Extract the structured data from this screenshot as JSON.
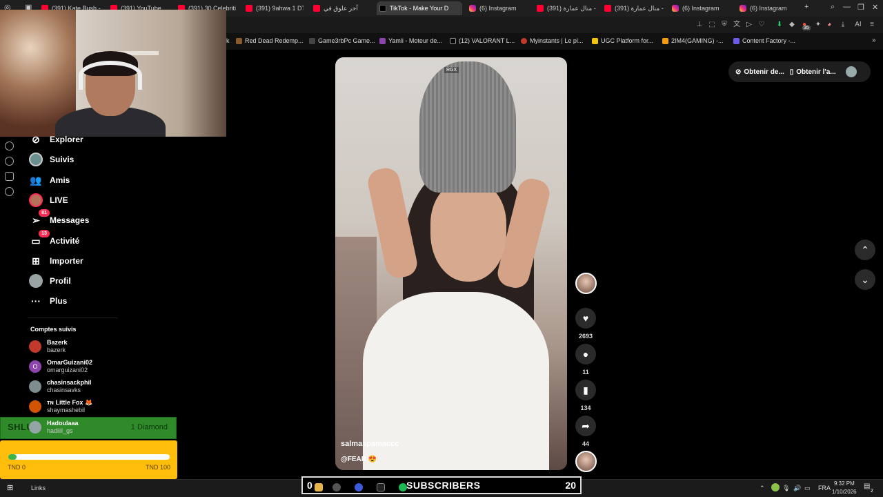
{
  "browser": {
    "tabs": [
      {
        "label": "(391) Kate Bush -",
        "icon": "youtube-icon"
      },
      {
        "label": "(391) YouTube",
        "icon": "youtube-icon"
      },
      {
        "label": "(391) 30 Celebriti",
        "icon": "youtube-icon"
      },
      {
        "label": "(391) 9ahwa 1 DT",
        "icon": "youtube-icon"
      },
      {
        "label": "آخر علوق في",
        "icon": "youtube-icon"
      },
      {
        "label": "TikTok - Make Your D",
        "icon": "tiktok-icon",
        "active": true
      },
      {
        "label": "(6) Instagram",
        "icon": "instagram-icon"
      },
      {
        "label": "(391) منال عمارة -",
        "icon": "youtube-icon"
      },
      {
        "label": "(391) منال عمارة -",
        "icon": "youtube-icon"
      },
      {
        "label": "(6) Instagram",
        "icon": "instagram-icon"
      },
      {
        "label": "(6) Instagram",
        "icon": "instagram-icon"
      }
    ],
    "new_tab": "+",
    "toolbar_ai": "AI",
    "bookmarks": [
      {
        "label": "k",
        "color": "#000"
      },
      {
        "label": "Red Dead Redemp...",
        "color": "#8b5a2b"
      },
      {
        "label": "Game3rbPc Game...",
        "color": "#444"
      },
      {
        "label": "Yamli - Moteur de...",
        "color": "#8e44ad"
      },
      {
        "label": "(12) VALORANT L...",
        "color": "#000"
      },
      {
        "label": "Myinstants | Le pl...",
        "color": "#c0392b"
      },
      {
        "label": "UGC Platform for...",
        "color": "#f1c40f"
      },
      {
        "label": "2IM4(GAMING) -...",
        "color": "#f39c12"
      },
      {
        "label": "Content Factory -...",
        "color": "#6c5ce7"
      }
    ],
    "toolbar_badge": "35"
  },
  "sidebar": {
    "items": [
      {
        "label": "Explorer",
        "icon": "compass-icon"
      },
      {
        "label": "Suivis",
        "icon": "following-avatar-icon"
      },
      {
        "label": "Amis",
        "icon": "friends-icon"
      },
      {
        "label": "LIVE",
        "icon": "live-avatar-icon"
      },
      {
        "label": "Messages",
        "icon": "messages-icon",
        "badge": "81"
      },
      {
        "label": "Activité",
        "icon": "activity-icon",
        "badge": "13"
      },
      {
        "label": "Importer",
        "icon": "upload-icon"
      },
      {
        "label": "Profil",
        "icon": "profile-avatar-icon"
      },
      {
        "label": "Plus",
        "icon": "more-icon"
      }
    ],
    "followed_title": "Comptes suivis",
    "accounts": [
      {
        "name": "Bazerk",
        "handle": "bazerk",
        "avatar_color": "#c0392b"
      },
      {
        "name": "OmarGuizani02",
        "handle": "omarguizani02",
        "avatar_color": "#8e44ad",
        "initial": "O"
      },
      {
        "name": "chasinsackphil",
        "handle": "chasinsavks",
        "avatar_color": "#7f8c8d"
      },
      {
        "name": "ᴛɴ Little Fox 🦊",
        "handle": "shaymashebil",
        "avatar_color": "#d35400"
      },
      {
        "name": "Hadoulaaa",
        "handle": "hadiiil_gs",
        "avatar_color": "#95a5a6"
      }
    ]
  },
  "overlay": {
    "green_left": "SHLUP",
    "green_right": "1 Diamond",
    "goal_min": "TND 0",
    "goal_max": "TND 100",
    "goal_progress_pct": 5,
    "subscribers_prefix": "0",
    "subscribers_label": "SUBSCRIBERS",
    "subscribers_count": "20"
  },
  "video": {
    "watermark": "RGX",
    "username": "salmaspamaccc",
    "caption": "@FEAR 😍",
    "likes": "2693",
    "comments": "11",
    "saves": "134",
    "shares": "44"
  },
  "top_actions": {
    "get_coins": "Obtenir de...",
    "get_app": "Obtenir l'a..."
  },
  "taskbar": {
    "links": "Links",
    "lang": "FRA",
    "time": "9:32 PM",
    "date": "1/10/2026",
    "notif_count": "2"
  }
}
